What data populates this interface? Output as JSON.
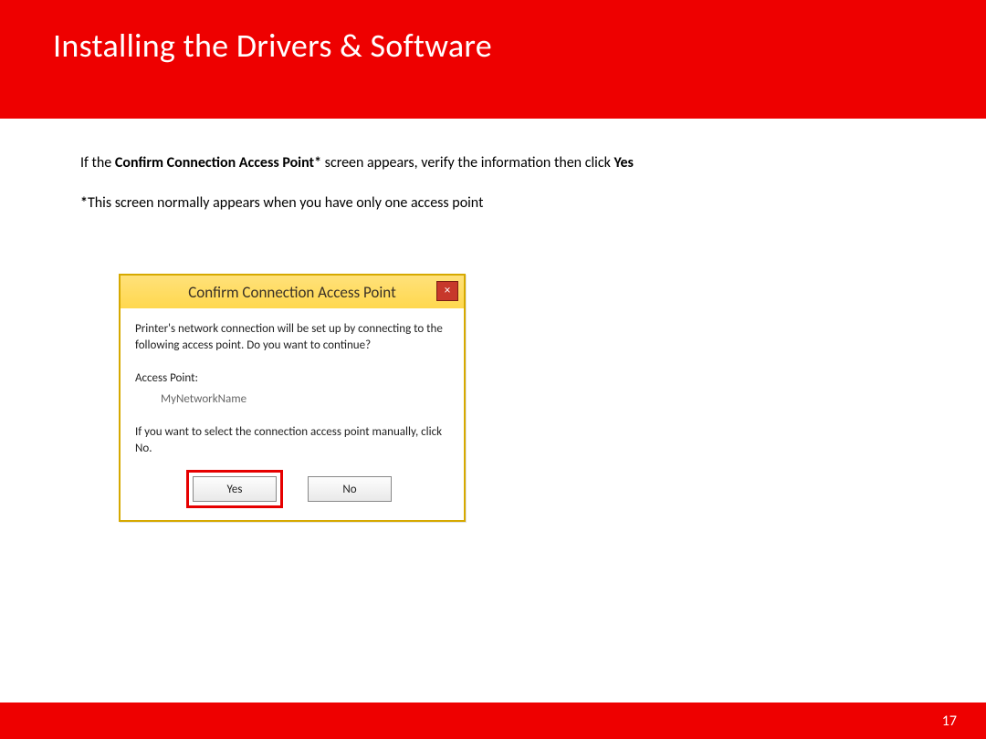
{
  "header": {
    "title": "Installing  the Drivers & Software"
  },
  "body": {
    "para1_pre": "If the ",
    "para1_bold1": "Confirm Connection Access Point*",
    "para1_mid": " screen appears, verify the information then click ",
    "para1_bold2": "Yes",
    "para2_pre": "*",
    "para2_text": "This screen normally appears when you have only one access point"
  },
  "dialog": {
    "title": "Confirm Connection Access Point",
    "close_glyph": "×",
    "msg1": "Printer's network connection will be set up by connecting to the following access point. Do you want to continue?",
    "ap_label": "Access Point:",
    "ap_name": "MyNetworkName",
    "msg2": "If you want to select the connection access point manually, click No.",
    "yes": "Yes",
    "no": "No"
  },
  "footer": {
    "page_number": "17"
  }
}
